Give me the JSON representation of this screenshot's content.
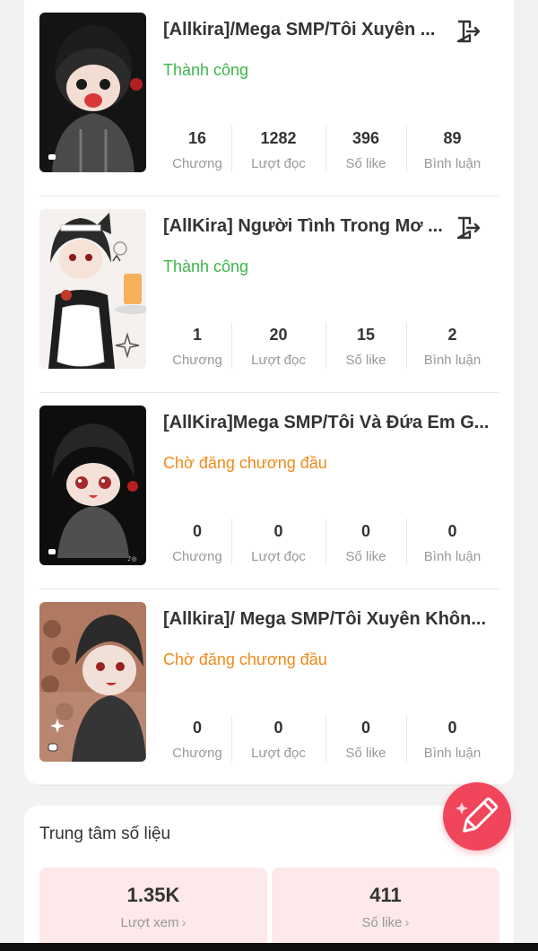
{
  "stories": [
    {
      "title": "[Allkira]/Mega SMP/Tôi Xuyên ...",
      "status": "Thành công",
      "status_type": "success",
      "stats": [
        {
          "value": "16",
          "label": "Chương"
        },
        {
          "value": "1282",
          "label": "Lượt đọc"
        },
        {
          "value": "396",
          "label": "Số like"
        },
        {
          "value": "89",
          "label": "Bình luận"
        }
      ]
    },
    {
      "title": "[AllKira] Người Tình Trong Mơ ...",
      "status": "Thành công",
      "status_type": "success",
      "stats": [
        {
          "value": "1",
          "label": "Chương"
        },
        {
          "value": "20",
          "label": "Lượt đọc"
        },
        {
          "value": "15",
          "label": "Số like"
        },
        {
          "value": "2",
          "label": "Bình luận"
        }
      ]
    },
    {
      "title": "[AllKira]Mega SMP/Tôi Và Đứa Em G...",
      "status": "Chờ đăng chương đầu",
      "status_type": "pending",
      "stats": [
        {
          "value": "0",
          "label": "Chương"
        },
        {
          "value": "0",
          "label": "Lượt đọc"
        },
        {
          "value": "0",
          "label": "Số like"
        },
        {
          "value": "0",
          "label": "Bình luận"
        }
      ]
    },
    {
      "title": "[Allkira]/ Mega SMP/Tôi Xuyên Khôn...",
      "status": "Chờ đăng chương đầu",
      "status_type": "pending",
      "stats": [
        {
          "value": "0",
          "label": "Chương"
        },
        {
          "value": "0",
          "label": "Lượt đọc"
        },
        {
          "value": "0",
          "label": "Số like"
        },
        {
          "value": "0",
          "label": "Bình luận"
        }
      ]
    }
  ],
  "data_center": {
    "title": "Trung tâm số liệu",
    "metrics": [
      {
        "value": "1.35K",
        "label": "Lượt xem"
      },
      {
        "value": "411",
        "label": "Số like"
      }
    ]
  },
  "icons": {
    "exit": "exit-icon",
    "chevron": "chevron-right-icon",
    "fab": "pencil-icon"
  },
  "colors": {
    "success": "#3cb64a",
    "pending": "#ef8a18",
    "accent": "#f0455b",
    "metric_bg": "#fde8ea"
  }
}
